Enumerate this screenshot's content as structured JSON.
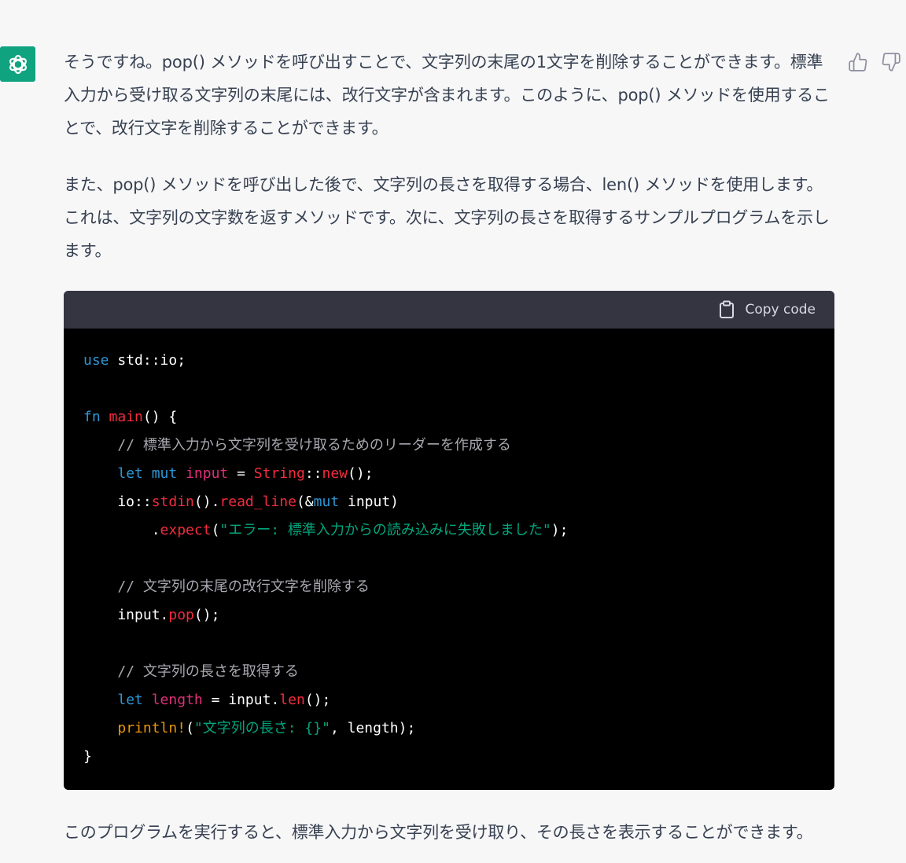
{
  "message": {
    "paragraphs": [
      "そうですね。pop() メソッドを呼び出すことで、文字列の末尾の1文字を削除することができます。標準入力から受け取る文字列の末尾には、改行文字が含まれます。このように、pop() メソッドを使用することで、改行文字を削除することができます。",
      "また、pop() メソッドを呼び出した後で、文字列の長さを取得する場合、len() メソッドを使用します。これは、文字列の文字数を返すメソッドです。次に、文字列の長さを取得するサンプルプログラムを示します。"
    ],
    "after_code": "このプログラムを実行すると、標準入力から文字列を受け取り、その長さを表示することができます。"
  },
  "code_block": {
    "copy_label": "Copy code",
    "lines": [
      [
        {
          "t": "use",
          "c": "kw"
        },
        {
          "t": " std::io;",
          "c": "pl"
        }
      ],
      [],
      [
        {
          "t": "fn",
          "c": "kw"
        },
        {
          "t": " ",
          "c": "pl"
        },
        {
          "t": "main",
          "c": "fn"
        },
        {
          "t": "() {",
          "c": "pl"
        }
      ],
      [
        {
          "t": "    ",
          "c": "pl"
        },
        {
          "t": "// 標準入力から文字列を受け取るためのリーダーを作成する",
          "c": "cm"
        }
      ],
      [
        {
          "t": "    ",
          "c": "pl"
        },
        {
          "t": "let",
          "c": "kw"
        },
        {
          "t": " ",
          "c": "pl"
        },
        {
          "t": "mut",
          "c": "kw"
        },
        {
          "t": " ",
          "c": "pl"
        },
        {
          "t": "input",
          "c": "ty"
        },
        {
          "t": " = ",
          "c": "pl"
        },
        {
          "t": "String",
          "c": "fn"
        },
        {
          "t": "::",
          "c": "pl"
        },
        {
          "t": "new",
          "c": "fn"
        },
        {
          "t": "();",
          "c": "pl"
        }
      ],
      [
        {
          "t": "    io::",
          "c": "pl"
        },
        {
          "t": "stdin",
          "c": "fn"
        },
        {
          "t": "().",
          "c": "pl"
        },
        {
          "t": "read_line",
          "c": "fn"
        },
        {
          "t": "(&",
          "c": "pl"
        },
        {
          "t": "mut",
          "c": "kw"
        },
        {
          "t": " input)",
          "c": "pl"
        }
      ],
      [
        {
          "t": "        .",
          "c": "pl"
        },
        {
          "t": "expect",
          "c": "fn"
        },
        {
          "t": "(",
          "c": "pl"
        },
        {
          "t": "\"エラー: 標準入力からの読み込みに失敗しました\"",
          "c": "str"
        },
        {
          "t": ");",
          "c": "pl"
        }
      ],
      [],
      [
        {
          "t": "    ",
          "c": "pl"
        },
        {
          "t": "// 文字列の末尾の改行文字を削除する",
          "c": "cm"
        }
      ],
      [
        {
          "t": "    input.",
          "c": "pl"
        },
        {
          "t": "pop",
          "c": "fn"
        },
        {
          "t": "();",
          "c": "pl"
        }
      ],
      [],
      [
        {
          "t": "    ",
          "c": "pl"
        },
        {
          "t": "// 文字列の長さを取得する",
          "c": "cm"
        }
      ],
      [
        {
          "t": "    ",
          "c": "pl"
        },
        {
          "t": "let",
          "c": "kw"
        },
        {
          "t": " ",
          "c": "pl"
        },
        {
          "t": "length",
          "c": "ty"
        },
        {
          "t": " = input.",
          "c": "pl"
        },
        {
          "t": "len",
          "c": "fn"
        },
        {
          "t": "();",
          "c": "pl"
        }
      ],
      [
        {
          "t": "    ",
          "c": "pl"
        },
        {
          "t": "println!",
          "c": "mac"
        },
        {
          "t": "(",
          "c": "pl"
        },
        {
          "t": "\"文字列の長さ: {}\"",
          "c": "str"
        },
        {
          "t": ", length);",
          "c": "pl"
        }
      ],
      [
        {
          "t": "}",
          "c": "pl"
        }
      ]
    ]
  },
  "icons": {
    "avatar": "chatgpt-logo-icon",
    "copy": "clipboard-icon",
    "like": "thumbs-up-icon",
    "dislike": "thumbs-down-icon"
  },
  "colors": {
    "avatar_bg": "#10a37f",
    "code_header_bg": "#343541",
    "code_bg": "#000000",
    "keyword": "#2e95d3",
    "function": "#f22c3d",
    "variable": "#df3079",
    "macro": "#e9950c",
    "string": "#00a67d",
    "comment": "#a8a8b0"
  }
}
